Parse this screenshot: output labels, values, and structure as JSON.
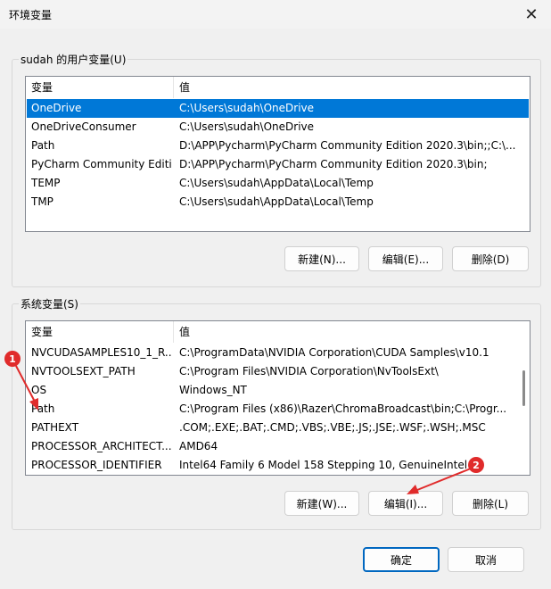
{
  "window": {
    "title": "环境变量",
    "close_glyph": "✕"
  },
  "user_vars": {
    "label": "sudah 的用户变量(U)",
    "columns": [
      "变量",
      "值"
    ],
    "rows": [
      {
        "name": "OneDrive",
        "value": "C:\\Users\\sudah\\OneDrive"
      },
      {
        "name": "OneDriveConsumer",
        "value": "C:\\Users\\sudah\\OneDrive"
      },
      {
        "name": "Path",
        "value": "D:\\APP\\Pycharm\\PyCharm Community Edition 2020.3\\bin;;C:\\..."
      },
      {
        "name": "PyCharm Community Editi...",
        "value": "D:\\APP\\Pycharm\\PyCharm Community Edition 2020.3\\bin;"
      },
      {
        "name": "TEMP",
        "value": "C:\\Users\\sudah\\AppData\\Local\\Temp"
      },
      {
        "name": "TMP",
        "value": "C:\\Users\\sudah\\AppData\\Local\\Temp"
      }
    ],
    "selected_index": 0,
    "buttons": {
      "new": "新建(N)...",
      "edit": "编辑(E)...",
      "delete": "删除(D)"
    }
  },
  "system_vars": {
    "label": "系统变量(S)",
    "columns": [
      "变量",
      "值"
    ],
    "rows": [
      {
        "name": "NVCUDASAMPLES10_1_R...",
        "value": "C:\\ProgramData\\NVIDIA Corporation\\CUDA Samples\\v10.1"
      },
      {
        "name": "NVTOOLSEXT_PATH",
        "value": "C:\\Program Files\\NVIDIA Corporation\\NvToolsExt\\"
      },
      {
        "name": "OS",
        "value": "Windows_NT"
      },
      {
        "name": "Path",
        "value": "C:\\Program Files (x86)\\Razer\\ChromaBroadcast\\bin;C:\\Progr..."
      },
      {
        "name": "PATHEXT",
        "value": ".COM;.EXE;.BAT;.CMD;.VBS;.VBE;.JS;.JSE;.WSF;.WSH;.MSC"
      },
      {
        "name": "PROCESSOR_ARCHITECT...",
        "value": "AMD64"
      },
      {
        "name": "PROCESSOR_IDENTIFIER",
        "value": "Intel64 Family 6 Model 158 Stepping 10, GenuineIntel"
      }
    ],
    "buttons": {
      "new": "新建(W)...",
      "edit": "编辑(I)...",
      "delete": "删除(L)"
    }
  },
  "footer": {
    "ok": "确定",
    "cancel": "取消"
  },
  "annotations": {
    "badge1": "1",
    "badge2": "2",
    "color": "#e02b2b"
  }
}
